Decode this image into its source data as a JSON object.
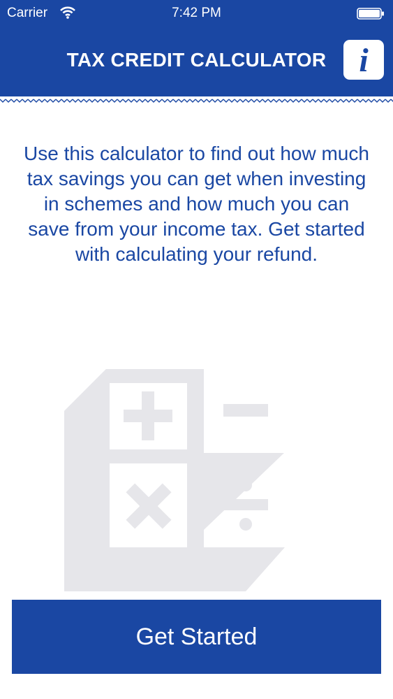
{
  "status_bar": {
    "carrier": "Carrier",
    "time": "7:42 PM",
    "wifi_icon": "wifi-icon",
    "battery_icon": "battery-icon"
  },
  "header": {
    "title": "TAX CREDIT CALCULATOR",
    "info_icon": "info-icon",
    "info_glyph": "i",
    "background_color": "#1a47a3"
  },
  "intro": {
    "text": "Use this calculator to find out how much tax savings you can get when investing in schemes and how much you can save from your income tax. Get started with calculating your refund."
  },
  "illustration": {
    "icon": "calculator-icon",
    "color": "#e6e6ea"
  },
  "actions": {
    "get_started_label": "Get Started"
  }
}
